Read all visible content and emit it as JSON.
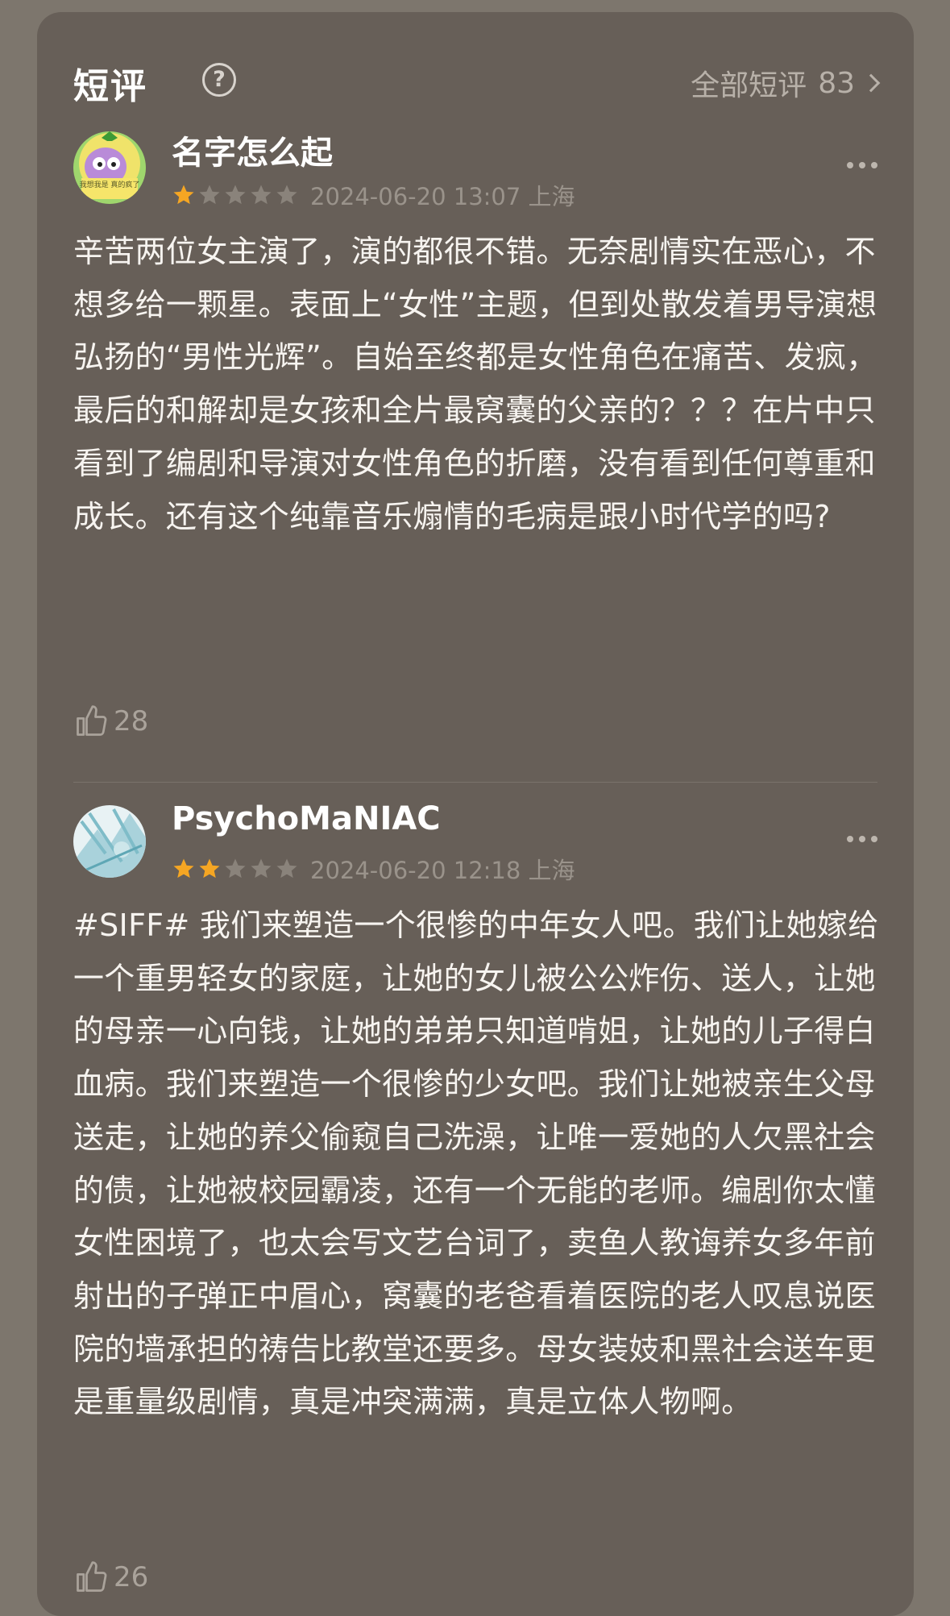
{
  "header": {
    "title": "短评",
    "help_icon": "?",
    "all_reviews_label": "全部短评",
    "all_reviews_count": "83"
  },
  "reviews": [
    {
      "username": "名字怎么起",
      "rating": 1,
      "max_rating": 5,
      "timestamp": "2024-06-20 13:07 上海",
      "avatar_text": "我想我是 真的疯了",
      "body": "辛苦两位女主演了，演的都很不错。无奈剧情实在恶心，不想多给一颗星。表面上“女性”主题，但到处散发着男导演想弘扬的“男性光辉”。自始至终都是女性角色在痛苦、发疯，最后的和解却是女孩和全片最窝囊的父亲的？？？在片中只看到了编剧和导演对女性角色的折磨，没有看到任何尊重和成长。还有这个纯靠音乐煽情的毛病是跟小时代学的吗?",
      "likes": "28"
    },
    {
      "username": "PsychoMaNIAC",
      "rating": 2,
      "max_rating": 5,
      "timestamp": "2024-06-20 12:18 上海",
      "body": "#SIFF# 我们来塑造一个很惨的中年女人吧。我们让她嫁给一个重男轻女的家庭，让她的女儿被公公炸伤、送人，让她的母亲一心向钱，让她的弟弟只知道啃姐，让她的儿子得白血病。我们来塑造一个很惨的少女吧。我们让她被亲生父母送走，让她的养父偷窥自己洗澡，让唯一爱她的人欠黑社会的债，让她被校园霸凌，还有一个无能的老师。编剧你太懂女性困境了，也太会写文艺台词了，卖鱼人教诲养女多年前射出的子弹正中眉心，窝囊的老爸看着医院的老人叹息说医院的墙承担的祷告比教堂还要多。母女装妓和黑社会送车更是重量级剧情，真是冲突满满，真是立体人物啊。",
      "likes": "26"
    }
  ],
  "colors": {
    "page_bg": "#7d766d",
    "card_bg": "#675f58",
    "star_filled": "#f5a623",
    "star_empty": "#8a837b"
  },
  "icons": {
    "help": "question-circle-icon",
    "more": "more-dots-icon",
    "like": "thumbs-up-icon",
    "chevron": "chevron-right-icon",
    "star": "star-icon"
  }
}
